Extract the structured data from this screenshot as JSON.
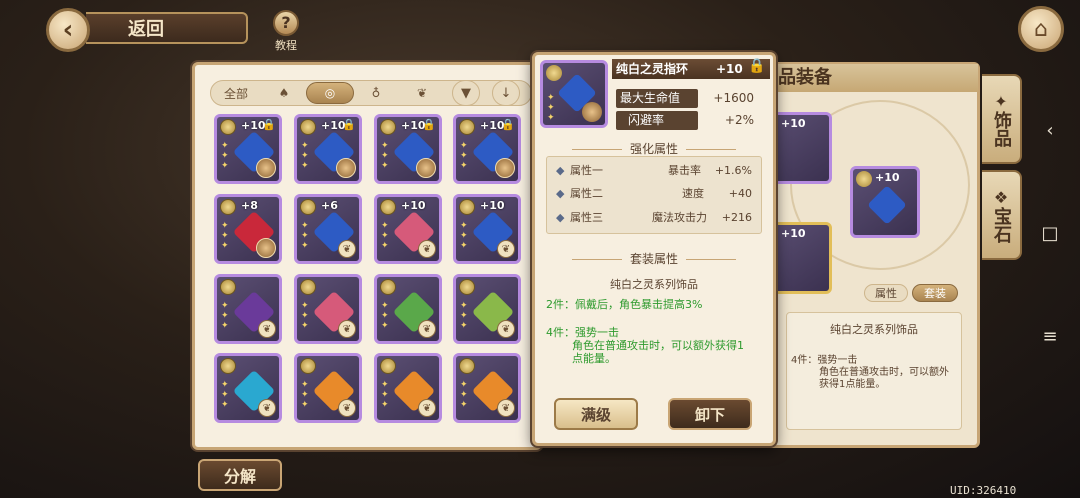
{
  "header": {
    "back_label": "返回",
    "tutorial_label": "教程",
    "tutorial_glyph": "?"
  },
  "filters": [
    {
      "label": "全部",
      "active": false
    },
    {
      "label": "",
      "icon": "hat-icon"
    },
    {
      "label": "",
      "icon": "ring-icon",
      "active": true
    },
    {
      "label": "",
      "icon": "necklace-icon"
    },
    {
      "label": "",
      "icon": "leaf-icon"
    }
  ],
  "inventory": [
    {
      "plus": "+10",
      "locked": true,
      "color": "#2d5bc4"
    },
    {
      "plus": "+10",
      "locked": true,
      "color": "#2d5bc4"
    },
    {
      "plus": "+10",
      "locked": true,
      "color": "#2d5bc4"
    },
    {
      "plus": "+10",
      "locked": true,
      "color": "#2d5bc4"
    },
    {
      "plus": "+8",
      "locked": false,
      "color": "#c9283a"
    },
    {
      "plus": "+6",
      "locked": false,
      "color": "#2d5bc4"
    },
    {
      "plus": "+10",
      "locked": false,
      "color": "#d65a7a"
    },
    {
      "plus": "+10",
      "locked": false,
      "color": "#2d5bc4"
    },
    {
      "plus": "",
      "locked": false,
      "color": "#6a3a9a"
    },
    {
      "plus": "",
      "locked": false,
      "color": "#d65a7a"
    },
    {
      "plus": "",
      "locked": false,
      "color": "#5aa84a"
    },
    {
      "plus": "",
      "locked": false,
      "color": "#8ab84a"
    },
    {
      "plus": "",
      "locked": false,
      "color": "#2aa8d0"
    },
    {
      "plus": "",
      "locked": false,
      "color": "#e88a2a"
    },
    {
      "plus": "",
      "locked": false,
      "color": "#e88a2a"
    },
    {
      "plus": "",
      "locked": false,
      "color": "#e88a2a"
    }
  ],
  "decompose_label": "分解",
  "detail": {
    "name": "纯白之灵指环",
    "level": "+10",
    "main_stats": [
      {
        "name": "最大生命值",
        "value": "+1600"
      },
      {
        "name": "闪避率",
        "value": "+2%"
      }
    ],
    "enhance_title": "强化属性",
    "subs": [
      {
        "slot": "属性一",
        "stat": "暴击率",
        "value": "+1.6%"
      },
      {
        "slot": "属性二",
        "stat": "速度",
        "value": "+40"
      },
      {
        "slot": "属性三",
        "stat": "魔法攻击力",
        "value": "+216"
      }
    ],
    "set_title": "套装属性",
    "set_name": "纯白之灵系列饰品",
    "set2": "2件：佩戴后，角色暴击提高3%",
    "set4_head": "4件：强势一击",
    "set4_body": "角色在普通攻击时，可以额外获得1点能量。",
    "btn_max": "满级",
    "btn_unequip": "卸下"
  },
  "equip_panel": {
    "title": "品装备",
    "slot_level": "+10",
    "tab_attr": "属性",
    "tab_set": "套装",
    "set_name": "纯白之灵系列饰品",
    "set4_head": "4件：强势一击",
    "set4_body": "角色在普通攻击时，可以额外获得1点能量。"
  },
  "side_tabs": [
    "饰品",
    "宝石"
  ],
  "uid": "UID:326410"
}
